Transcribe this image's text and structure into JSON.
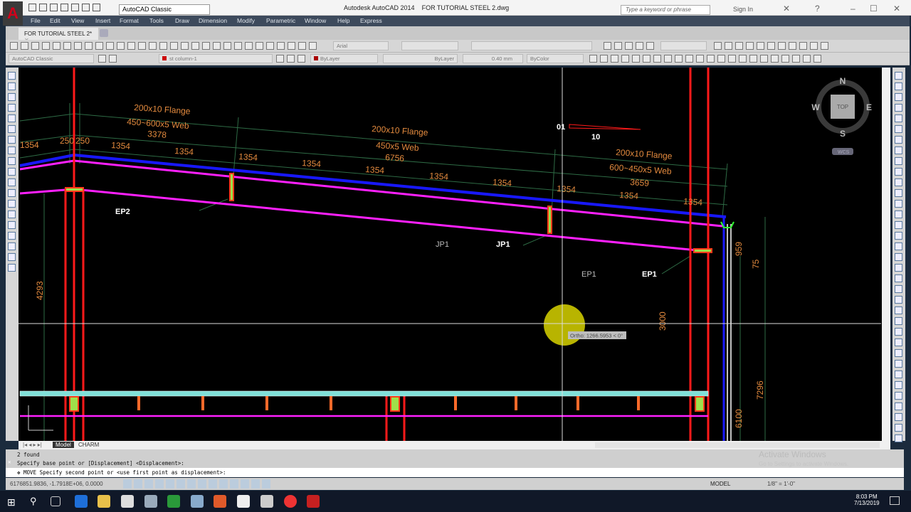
{
  "app": {
    "title": "Autodesk AutoCAD 2014",
    "filename": "FOR TUTORIAL STEEL 2.dwg",
    "workspace": "AutoCAD Classic",
    "search_placeholder": "Type a keyword or phrase",
    "sign_in": "Sign In",
    "logo": "A"
  },
  "menu": [
    "File",
    "Edit",
    "View",
    "Insert",
    "Format",
    "Tools",
    "Draw",
    "Dimension",
    "Modify",
    "Parametric",
    "Window",
    "Help",
    "Express"
  ],
  "doc_tab": "FOR TUTORIAL STEEL 2*",
  "toolbar": {
    "font": "Arial",
    "workspace2": "AutoCAD Classic",
    "layer": "st column-1",
    "color": "ByLayer",
    "linetype": "ByLayer",
    "lineweight": "0.40 mm",
    "plotstyle": "ByColor"
  },
  "viewcube": {
    "n": "N",
    "s": "S",
    "e": "E",
    "w": "W",
    "top": "TOP",
    "wcs": "WCS"
  },
  "drawing": {
    "labels": {
      "flange1": "200x10 Flange",
      "web1": "450~600x5 Web",
      "len1": "3378",
      "flange2": "200x10 Flange",
      "web2": "450x5 Web",
      "len2": "6756",
      "flange3": "200x10 Flange",
      "web3": "600~450x5 Web",
      "len3": "3659",
      "d1354": "1354",
      "d250a": "250",
      "d250b": "250",
      "ep2": "EP2",
      "jp1a": "JP1",
      "jp1b": "JP1",
      "ep1a": "EP1",
      "ep1b": "EP1",
      "n01": "01",
      "n10": "10",
      "d4293": "4293",
      "d3000": "3000",
      "d959": "959",
      "d75": "75",
      "d7296": "7296",
      "d6100": "6100",
      "d1354x": "1354"
    },
    "tooltip": "Ortho: 1266.5953 < 0°"
  },
  "layout_tabs": [
    "Model",
    "CHARM"
  ],
  "command": {
    "history": [
      "2 found",
      "Specify base point or [Displacement] <Displacement>:"
    ],
    "current": "MOVE Specify second point or <use first point as displacement>:"
  },
  "status": {
    "coords": "6176851.9836, -1.7918E+06, 0.0000",
    "model": "MODEL",
    "scale": "1/8\" = 1'-0\""
  },
  "watermark": {
    "title": "Activate Windows",
    "sub": "Go to Settings to activate Windows."
  },
  "taskbar": {
    "time": "8:03 PM",
    "date": "7/13/2019"
  },
  "colors": {
    "orange": "#e38a3e",
    "blue": "#1818ff",
    "magenta": "#ff20ff",
    "red": "#ff1a1a",
    "green": "#2e6b45",
    "cyan": "#7fe0d8"
  }
}
